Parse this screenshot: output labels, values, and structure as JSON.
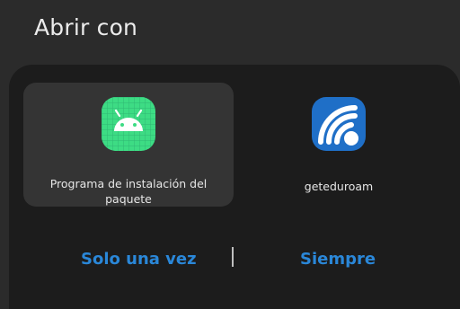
{
  "dialog": {
    "title": "Abrir con"
  },
  "apps": [
    {
      "label": "Programa de instalación del paquete",
      "icon": "android-icon",
      "selected": true
    },
    {
      "label": "geteduroam",
      "icon": "wifi-icon",
      "selected": false
    }
  ],
  "actions": {
    "once_label": "Solo una vez",
    "always_label": "Siempre"
  },
  "colors": {
    "accent": "#2a87d8",
    "android_green": "#3ddc84",
    "geteduroam_blue": "#1f6fc7"
  }
}
